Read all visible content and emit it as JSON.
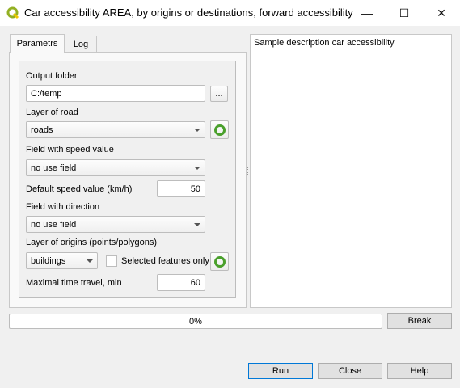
{
  "window": {
    "title": "Car accessibility AREA, by origins or destinations, forward accessibility",
    "minimize": "—",
    "maximize": "☐",
    "close": "✕"
  },
  "tabs": [
    {
      "label": "Parametrs"
    },
    {
      "label": "Log"
    }
  ],
  "form": {
    "output_folder": {
      "label": "Output folder",
      "value": "C:/temp",
      "browse": "..."
    },
    "layer_road": {
      "label": "Layer of road",
      "value": "roads"
    },
    "speed_field": {
      "label": "Field with speed value",
      "value": "no use field"
    },
    "default_speed": {
      "label": "Default speed value (km/h)",
      "value": "50"
    },
    "direction_field": {
      "label": "Field with direction",
      "value": "no use field"
    },
    "layer_origins": {
      "label": "Layer of origins (points/polygons)",
      "value": "buildings",
      "selected_only": "Selected features only",
      "selected_checked": false
    },
    "max_time": {
      "label": "Maximal time travel, min",
      "value": "60"
    }
  },
  "description": "Sample description car accessibility",
  "progress": {
    "value": 0,
    "text": "0%"
  },
  "buttons": {
    "break": "Break",
    "run": "Run",
    "close": "Close",
    "help": "Help"
  }
}
